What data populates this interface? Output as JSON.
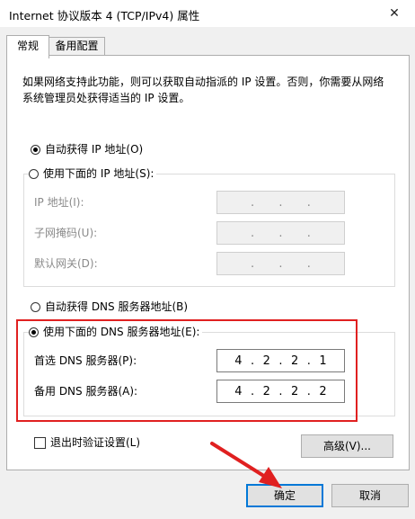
{
  "window": {
    "title": "Internet 协议版本 4 (TCP/IPv4) 属性",
    "close_glyph": "✕"
  },
  "tabs": [
    {
      "label": "常规"
    },
    {
      "label": "备用配置"
    }
  ],
  "description": "如果网络支持此功能，则可以获取自动指派的 IP 设置。否则，你需要从网络系统管理员处获得适当的 IP 设置。",
  "ip_section": {
    "auto_label": "自动获得 IP 地址(O)",
    "manual_label": "使用下面的 IP 地址(S):",
    "fields": [
      {
        "label": "IP 地址(I):"
      },
      {
        "label": "子网掩码(U):"
      },
      {
        "label": "默认网关(D):"
      }
    ]
  },
  "dns_section": {
    "auto_label": "自动获得 DNS 服务器地址(B)",
    "manual_label": "使用下面的 DNS 服务器地址(E):",
    "preferred_label": "首选 DNS 服务器(P):",
    "preferred_value": [
      "4",
      "2",
      "2",
      "1"
    ],
    "alternate_label": "备用 DNS 服务器(A):",
    "alternate_value": [
      "4",
      "2",
      "2",
      "2"
    ]
  },
  "validate_label": "退出时验证设置(L)",
  "buttons": {
    "advanced": "高级(V)...",
    "ok": "确定",
    "cancel": "取消"
  },
  "colors": {
    "highlight": "#e02020",
    "arrow": "#e02020",
    "focus": "#0078d7"
  }
}
